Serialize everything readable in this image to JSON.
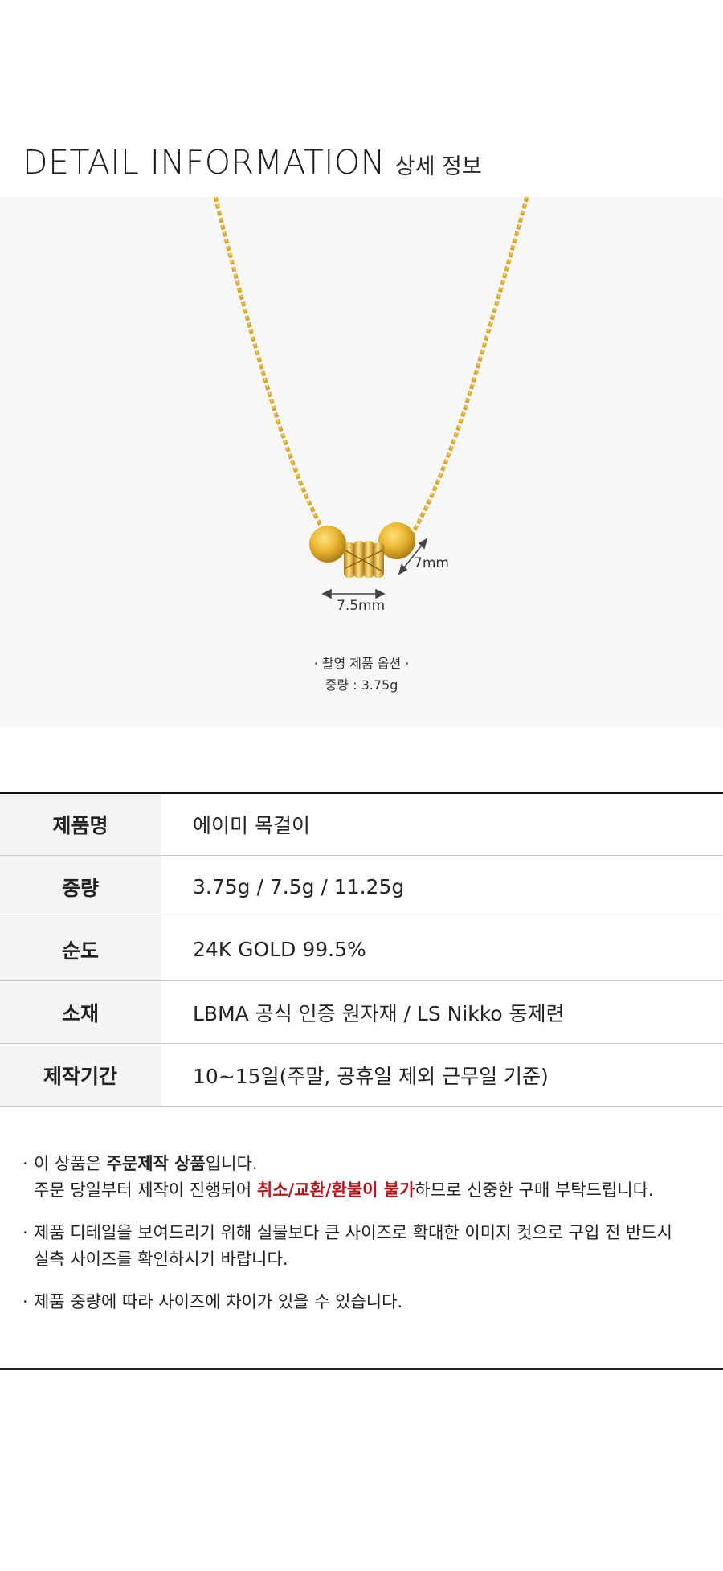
{
  "header": {
    "title_en": "DETAIL INFORMATION",
    "title_ko": "상세 정보"
  },
  "photo": {
    "dim_width": "7.5mm",
    "dim_height": "7mm",
    "caption_line1": "· 촬영 제품 옵션 ·",
    "caption_line2": "중량 : 3.75g"
  },
  "spec": {
    "rows": [
      {
        "label": "제품명",
        "value": "에이미 목걸이"
      },
      {
        "label": "중량",
        "value": "3.75g / 7.5g / 11.25g"
      },
      {
        "label": "순도",
        "value": "24K GOLD 99.5%"
      },
      {
        "label": "소재",
        "value": "LBMA 공식 인증 원자재 / LS Nikko 동제련"
      },
      {
        "label": "제작기간",
        "value": "10~15일(주말, 공휴일 제외 근무일 기준)"
      }
    ]
  },
  "notes": {
    "bullet": "·",
    "n1_a": "이 상품은 ",
    "n1_b": "주문제작 상품",
    "n1_c": "입니다.",
    "n1_d": "주문 당일부터 제작이 진행되어 ",
    "n1_e": "취소/교환/환불이 불가",
    "n1_f": "하므로 신중한 구매 부탁드립니다.",
    "n2_a": "제품 디테일을 보여드리기 위해 실물보다 큰 사이즈로 확대한 이미지 컷으로 구입 전 반드시",
    "n2_b": "실측 사이즈를 확인하시기 바랍니다.",
    "n3": " 제품 중량에 따라 사이즈에 차이가 있을 수 있습니다."
  },
  "colors": {
    "gold": "#e8b830",
    "gold_dark": "#b9851a",
    "red_text": "#b8161d"
  }
}
